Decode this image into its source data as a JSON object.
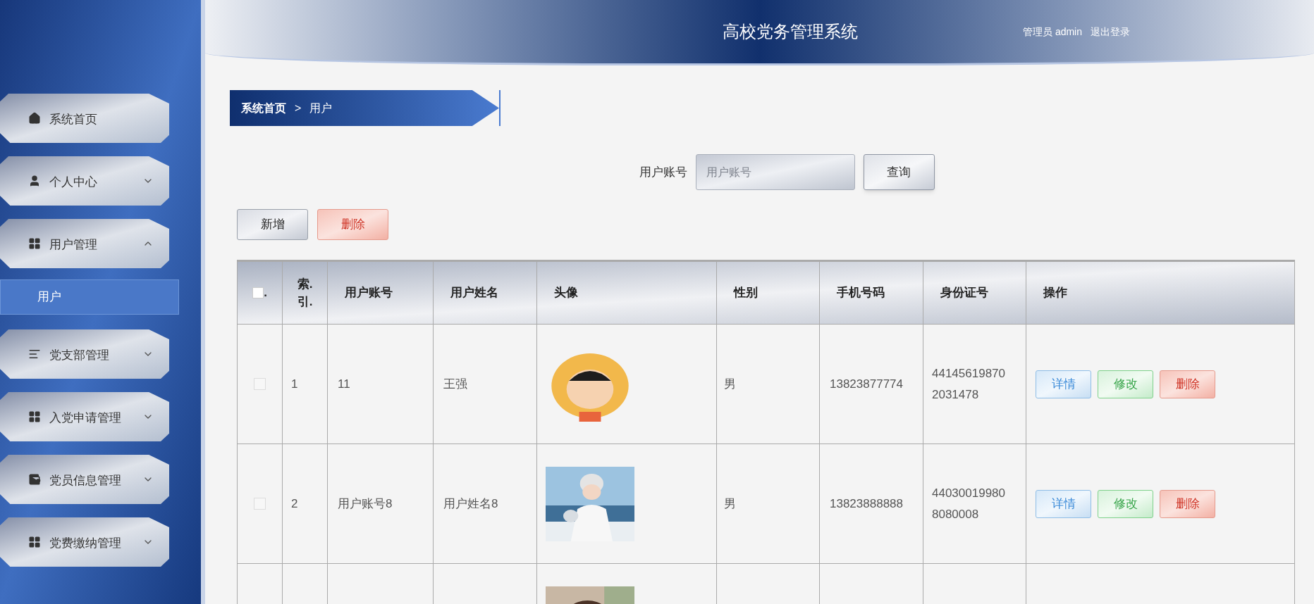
{
  "header": {
    "title": "高校党务管理系统",
    "user": "管理员 admin",
    "logout": "退出登录"
  },
  "sidebar": {
    "items": [
      {
        "label": "系统首页",
        "kind": "home"
      },
      {
        "label": "个人中心",
        "kind": "user",
        "expanded": false
      },
      {
        "label": "用户管理",
        "kind": "grid",
        "expanded": true,
        "children": [
          {
            "label": "用户",
            "selected": true
          }
        ]
      },
      {
        "label": "党支部管理",
        "kind": "list",
        "expanded": false
      },
      {
        "label": "入党申请管理",
        "kind": "grid",
        "expanded": false
      },
      {
        "label": "党员信息管理",
        "kind": "wallet",
        "expanded": false
      },
      {
        "label": "党费缴纳管理",
        "kind": "grid",
        "expanded": false
      }
    ]
  },
  "breadcrumb": {
    "home": "系统首页",
    "separator": ">",
    "current": "用户"
  },
  "search": {
    "label": "用户账号",
    "placeholder": "用户账号",
    "button": "查询"
  },
  "toolbar": [
    {
      "label": "新增",
      "kind": "add"
    },
    {
      "label": "删除",
      "kind": "delete"
    }
  ],
  "table": {
    "header_checked": false,
    "columns": [
      ".",
      "索.引.",
      "用户账号",
      "用户姓名",
      "头像",
      "性别",
      "手机号码",
      "身份证号",
      "操作"
    ],
    "rows": [
      {
        "checked": false,
        "index": "1",
        "account": "11",
        "name": "王强",
        "avatar": {
          "kind": "picture"
        },
        "gender": "男",
        "phone": "13823877774",
        "id_number": "44145619870 2031478",
        "actions": [
          {
            "label": "详情",
            "kind": "detail"
          },
          {
            "label": "修改",
            "kind": "edit"
          },
          {
            "label": "删除",
            "kind": "delete"
          }
        ]
      },
      {
        "checked": false,
        "index": "2",
        "account": "用户账号8",
        "name": "用户姓名8",
        "avatar": {
          "kind": "picture"
        },
        "gender": "男",
        "phone": "13823888888",
        "id_number": "44030019980 8080008",
        "actions": [
          {
            "label": "详情",
            "kind": "detail"
          },
          {
            "label": "修改",
            "kind": "edit"
          },
          {
            "label": "删除",
            "kind": "delete"
          }
        ]
      },
      {
        "avatar": {
          "kind": "picture"
        }
      }
    ]
  }
}
